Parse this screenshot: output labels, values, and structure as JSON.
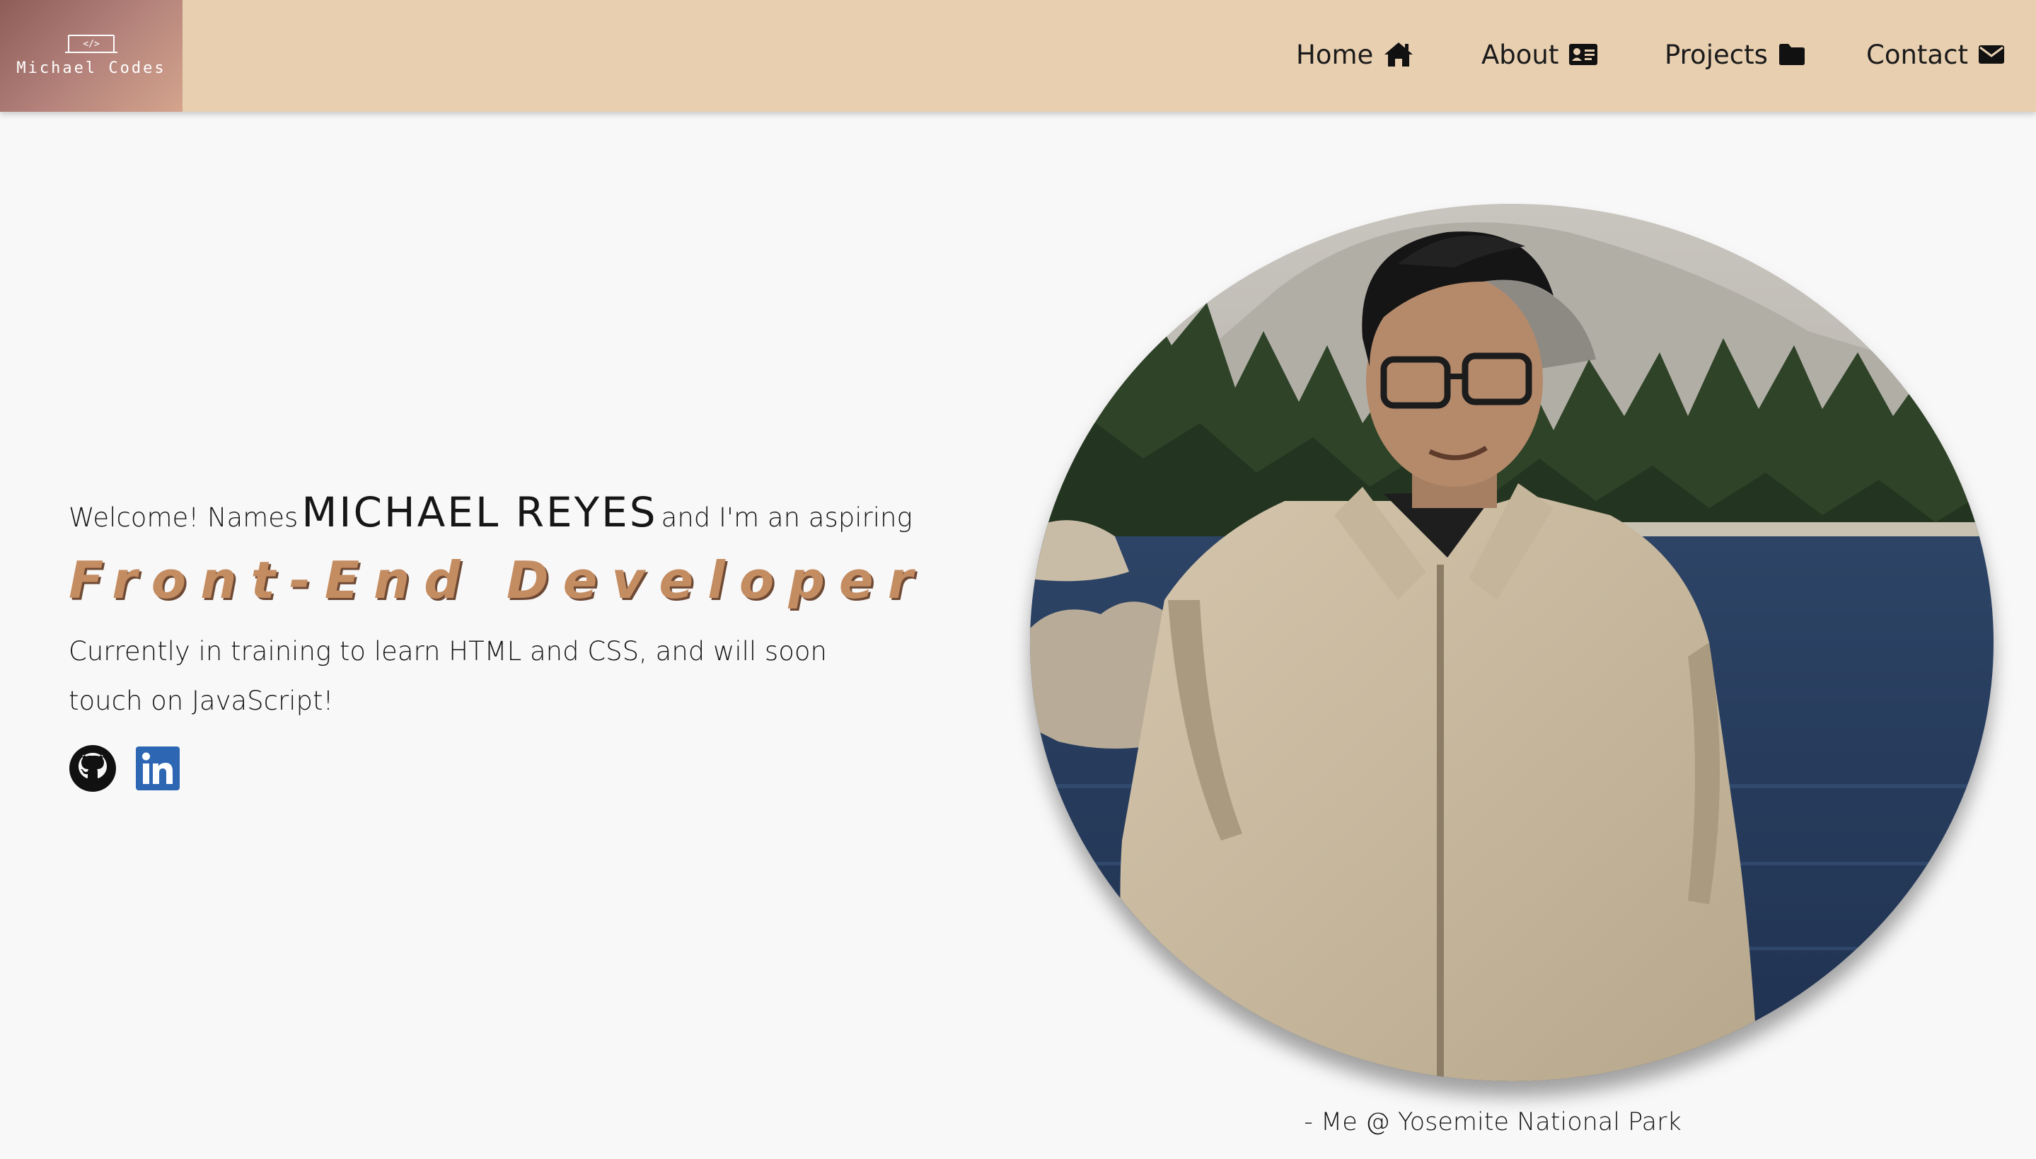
{
  "logo": {
    "mark": "</>",
    "text": "Michael Codes",
    "icon": "laptop-code-icon"
  },
  "nav": [
    {
      "label": "Home",
      "icon": "home-icon"
    },
    {
      "label": "About",
      "icon": "id-card-icon"
    },
    {
      "label": "Projects",
      "icon": "folder-icon"
    },
    {
      "label": "Contact",
      "icon": "envelope-icon"
    }
  ],
  "hero": {
    "intro_prefix": "Welcome! Names",
    "name": "MICHAEL REYES",
    "intro_suffix": "and I'm an aspiring",
    "role": "Front-End Developer",
    "blurb": "Currently in training to learn HTML and CSS, and will soon touch on JavaScript!"
  },
  "socials": [
    {
      "name": "GitHub",
      "icon": "github-icon"
    },
    {
      "name": "LinkedIn",
      "icon": "linkedin-icon"
    }
  ],
  "photo": {
    "caption": "- Me @ Yosemite National Park"
  },
  "colors": {
    "header_bg": "#e8cfb0",
    "page_bg": "#f8f8f8",
    "accent": "#c48c61",
    "linkedin": "#2d66b2"
  }
}
